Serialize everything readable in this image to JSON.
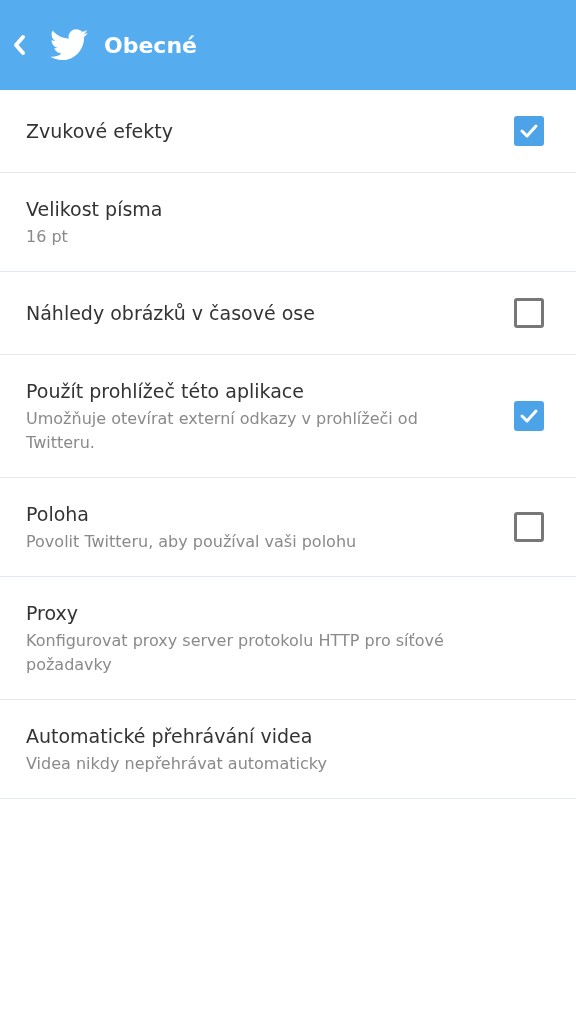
{
  "header": {
    "title": "Obecné"
  },
  "settings": [
    {
      "kind": "checkbox",
      "title": "Zvukové efekty",
      "checked": true
    },
    {
      "kind": "plain",
      "title": "Velikost písma",
      "subtitle": "16 pt"
    },
    {
      "kind": "checkbox",
      "title": "Náhledy obrázků v časové ose",
      "checked": false
    },
    {
      "kind": "checkbox",
      "title": "Použít prohlížeč této aplikace",
      "subtitle": "Umožňuje otevírat externí odkazy v prohlížeči od Twitteru.",
      "checked": true
    },
    {
      "kind": "checkbox",
      "title": "Poloha",
      "subtitle": "Povolit Twitteru, aby používal vaši polohu",
      "checked": false
    },
    {
      "kind": "plain",
      "title": "Proxy",
      "subtitle": "Konfigurovat proxy server protokolu HTTP pro síťové požadavky"
    },
    {
      "kind": "plain",
      "title": "Automatické přehrávání videa",
      "subtitle": "Videa nikdy nepřehrávat automaticky"
    }
  ]
}
